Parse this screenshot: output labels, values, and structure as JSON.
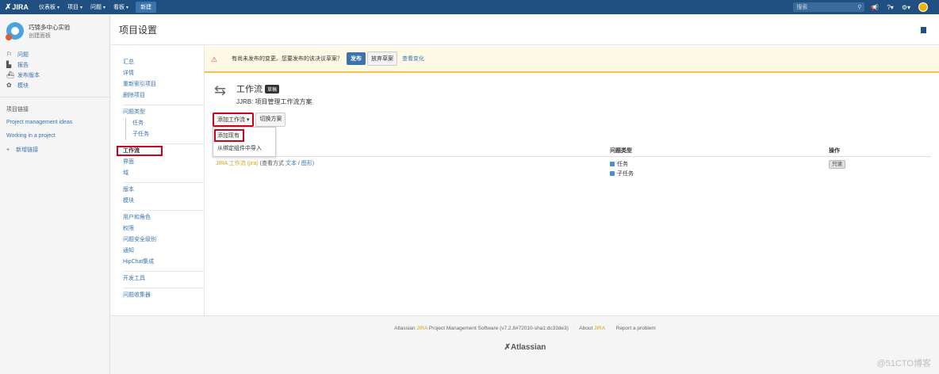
{
  "topbar": {
    "logo": "JIRA",
    "nav": [
      "仪表板",
      "项目",
      "问题",
      "看板"
    ],
    "create": "新建",
    "search_placeholder": "搜索"
  },
  "sidebar": {
    "project_name": "巧锦多中心实验",
    "project_sub": "创建面板",
    "items": [
      {
        "icon": "issues-icon",
        "label": "问题"
      },
      {
        "icon": "reports-icon",
        "label": "报告"
      },
      {
        "icon": "release-icon",
        "label": "发布版本"
      },
      {
        "icon": "components-icon",
        "label": "模块"
      }
    ],
    "section": "项目链接",
    "links": [
      "Project management ideas",
      "Working in a project"
    ],
    "add_link": "新增链接"
  },
  "page": {
    "title": "项目设置"
  },
  "settings_nav": {
    "groups": [
      [
        "汇总",
        "详情",
        "重新索引项目",
        "删除项目"
      ],
      [
        "问题类型",
        "任务",
        "子任务"
      ],
      [
        "工作流",
        "界面",
        "域"
      ],
      [
        "版本",
        "模块"
      ],
      [
        "用户和角色",
        "权限",
        "问题安全级别",
        "通知",
        "HipChat集成"
      ],
      [
        "开发工具"
      ],
      [
        "问题收集器"
      ]
    ]
  },
  "warning": {
    "text": "有尚未发布的变更。您要发布的该决议草案？",
    "publish": "发布",
    "discard": "放弃草案",
    "view_changes": "查看变化"
  },
  "workflow": {
    "title": "工作流",
    "badge": "草稿",
    "scheme": "JJRB: 项目管理工作流方案",
    "add_btn": "添加工作流",
    "switch_btn": "切换方案",
    "dropdown": [
      "添加现有",
      "从绑定组件中导入"
    ]
  },
  "table": {
    "headers": [
      "",
      "问题类型",
      "操作"
    ],
    "row": {
      "name": "JIRA 工作流 (jira)",
      "view_as": "(查看方式",
      "text_link": "文本",
      "slash": "/",
      "diagram_link": "图形)",
      "types": [
        "任务",
        "子任务"
      ],
      "op": "只读"
    }
  },
  "footer": {
    "line_prefix": "Atlassian",
    "jira": "JIRA",
    "line_mid": "Project Management Software (v7.2.8#72010-sha1:dc33de3)",
    "about": "About",
    "report": "Report a problem",
    "logo": "Atlassian",
    "watermark": "@51CTO博客"
  },
  "colors": {
    "brand": "#205081",
    "link": "#3b73af",
    "highlight": "#d0021b",
    "warning_border": "#f6c342"
  }
}
